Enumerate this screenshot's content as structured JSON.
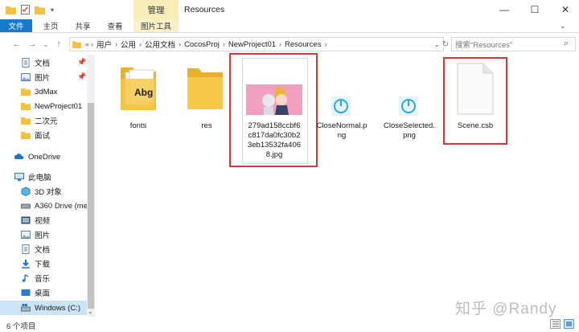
{
  "window": {
    "title": "Resources",
    "context_tab": "管理",
    "controls": [
      "—",
      "☐",
      "✕"
    ]
  },
  "ribbon": {
    "tabs": [
      "文件",
      "主页",
      "共享",
      "查看",
      "图片工具"
    ]
  },
  "nav": {
    "back": "←",
    "forward": "→",
    "dropdown": "⌄",
    "up": "↑",
    "overflow": "«",
    "refresh": "↻"
  },
  "breadcrumb": [
    "用户",
    "公用",
    "公用文档",
    "CocosProj",
    "NewProject01",
    "Resources"
  ],
  "search": {
    "placeholder": "搜索\"Resources\"",
    "icon": "⌕"
  },
  "sidebar": {
    "items": [
      {
        "label": "文档",
        "icon": "documents-icon",
        "pinned": true
      },
      {
        "label": "图片",
        "icon": "pictures-icon",
        "pinned": true
      },
      {
        "label": "3dMax",
        "icon": "folder-icon"
      },
      {
        "label": "NewProject01",
        "icon": "folder-icon"
      },
      {
        "label": "二次元",
        "icon": "folder-icon"
      },
      {
        "label": "面试",
        "icon": "folder-icon"
      },
      {
        "label": "OneDrive",
        "icon": "cloud-icon"
      },
      {
        "label": "此电脑",
        "icon": "computer-icon"
      },
      {
        "label": "3D 对象",
        "icon": "3d-objects-icon"
      },
      {
        "label": "A360 Drive (me",
        "icon": "drive-icon"
      },
      {
        "label": "视频",
        "icon": "videos-icon"
      },
      {
        "label": "图片",
        "icon": "pictures-icon"
      },
      {
        "label": "文档",
        "icon": "documents-icon"
      },
      {
        "label": "下载",
        "icon": "download-icon"
      },
      {
        "label": "音乐",
        "icon": "music-icon"
      },
      {
        "label": "桌面",
        "icon": "desktop-icon"
      },
      {
        "label": "Windows (C:)",
        "icon": "windows-drive-icon"
      }
    ],
    "pin_glyph": "📌",
    "scroll_down": "⌄"
  },
  "files": [
    {
      "name": "fonts",
      "type": "folder"
    },
    {
      "name": "res",
      "type": "folder"
    },
    {
      "name": "279ad158ccbf6c817da0fc30b23eb13532fa4068.jpg",
      "type": "image",
      "lines": [
        "279ad158ccbf6",
        "c817da0fc30b2",
        "3eb13532fa406",
        "8.jpg"
      ]
    },
    {
      "name": "CloseNormal.png",
      "type": "png",
      "lines": [
        "CloseNormal.p",
        "ng"
      ]
    },
    {
      "name": "CloseSelected.png",
      "type": "png",
      "lines": [
        "CloseSelected.",
        "png"
      ]
    },
    {
      "name": "Scene.csb",
      "type": "file"
    }
  ],
  "fonts_thumb_text": "Abg",
  "status": {
    "count": "6 个项目"
  },
  "watermark": "知乎 @Randy",
  "colors": {
    "accent": "#1979ca",
    "highlight": "#d23a3a",
    "selection": "#cce4f7",
    "folder": "#f4c23c"
  }
}
